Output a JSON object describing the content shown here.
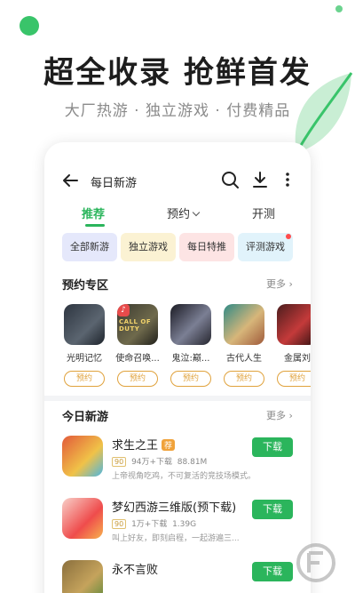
{
  "promo": {
    "headline": "超全收录 抢鲜首发",
    "subline": "大厂热游 · 独立游戏 · 付费精品"
  },
  "header": {
    "title": "每日新游"
  },
  "tabs": [
    {
      "label": "推荐"
    },
    {
      "label": "预约"
    },
    {
      "label": "开测"
    }
  ],
  "chips": [
    {
      "label": "全部新游"
    },
    {
      "label": "独立游戏"
    },
    {
      "label": "每日特推"
    },
    {
      "label": "评测游戏"
    }
  ],
  "reserve_section": {
    "title": "预约专区",
    "more": "更多",
    "items": [
      {
        "name": "光明记忆",
        "button": "预约"
      },
      {
        "name": "使命召唤...",
        "button": "预约",
        "cover_text": "CALL OF DUTY"
      },
      {
        "name": "鬼泣:巅...",
        "button": "预约"
      },
      {
        "name": "古代人生",
        "button": "预约"
      },
      {
        "name": "金属刘",
        "button": "预约"
      }
    ]
  },
  "today_section": {
    "title": "今日新游",
    "more": "更多",
    "games": [
      {
        "title": "求生之王",
        "tag": "荐",
        "grade": "90",
        "downloads": "94万+下载",
        "size": "88.81M",
        "desc": "上帝视角吃鸡，不可复活的竞技场模式。",
        "button": "下载"
      },
      {
        "title": "梦幻西游三维版(预下载)",
        "grade": "90",
        "downloads": "1万+下载",
        "size": "1.39G",
        "desc": "叫上好友，即刻启程，一起游遍三...",
        "button": "下载"
      },
      {
        "title": "永不言败",
        "button": "下载"
      }
    ]
  },
  "colors": {
    "accent": "#2bb55c",
    "reserve": "#e0a23c"
  }
}
